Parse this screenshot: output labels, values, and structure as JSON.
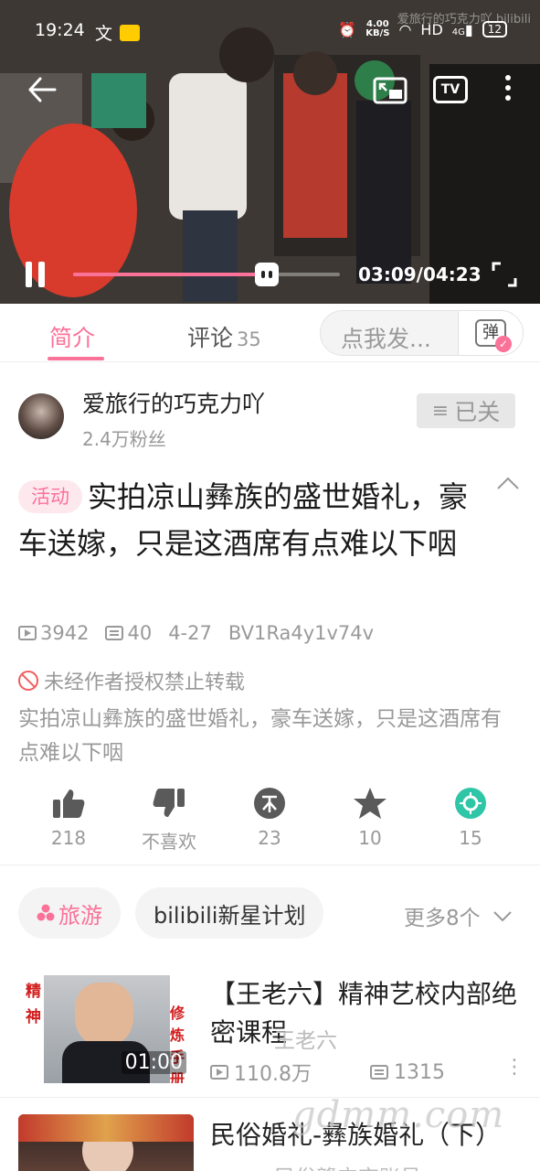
{
  "status_bar": {
    "time": "19:24",
    "speed_value": "4.00",
    "speed_unit": "KB/S",
    "hd": "HD",
    "net": "4G",
    "battery": "12"
  },
  "player": {
    "watermark": "爱旅行的巧克力吖 bilibili",
    "progress_fraction": 0.726,
    "time_display": "03:09/04:23",
    "icons": {
      "back": "back-arrow-icon",
      "pip": "picture-in-picture-icon",
      "cast": "tv-cast-icon",
      "menu": "more-vertical-icon",
      "pause": "pause-icon",
      "fullscreen": "fullscreen-icon"
    },
    "tv_label": "TV"
  },
  "tabs": {
    "intro": "简介",
    "comments": "评论",
    "comments_count": "35",
    "danmaku_placeholder": "点我发...",
    "danmaku_icon": "弹"
  },
  "uploader": {
    "name": "爱旅行的巧克力吖",
    "fans": "2.4万粉丝",
    "follow_label": "已关"
  },
  "video": {
    "badge": "活动",
    "title": "实拍凉山彝族的盛世婚礼，豪车送嫁，只是这酒席有点难以下咽",
    "views": "3942",
    "danmaku_count": "40",
    "date": "4-27",
    "bvid": "BV1Ra4y1v74v",
    "notice": "未经作者授权禁止转载",
    "description": "实拍凉山彝族的盛世婚礼，豪车送嫁，只是这酒席有点难以下咽"
  },
  "actions": [
    {
      "icon": "thumbs-up-icon",
      "label": "218"
    },
    {
      "icon": "thumbs-down-icon",
      "label": "不喜欢"
    },
    {
      "icon": "coin-icon",
      "label": "23"
    },
    {
      "icon": "star-icon",
      "label": "10"
    },
    {
      "icon": "share-icon",
      "label": "15"
    }
  ],
  "tags": {
    "travel": "旅游",
    "plan": "bilibili新星计划",
    "more": "更多8个"
  },
  "recommendations": [
    {
      "title": "【王老六】精神艺校内部绝密课程",
      "uploader": "王老六",
      "duration": "01:00",
      "views": "110.8万",
      "danmaku": "1315",
      "thumb_left": "精神",
      "thumb_right": "修炼手册"
    },
    {
      "title": "民俗婚礼-彝族婚礼（下）",
      "uploader": "民俗赣宁京账号"
    }
  ],
  "site_watermark": "gdmm.com",
  "colors": {
    "accent": "#fb7299",
    "gray": "#999999",
    "share": "#2ec6a6"
  }
}
